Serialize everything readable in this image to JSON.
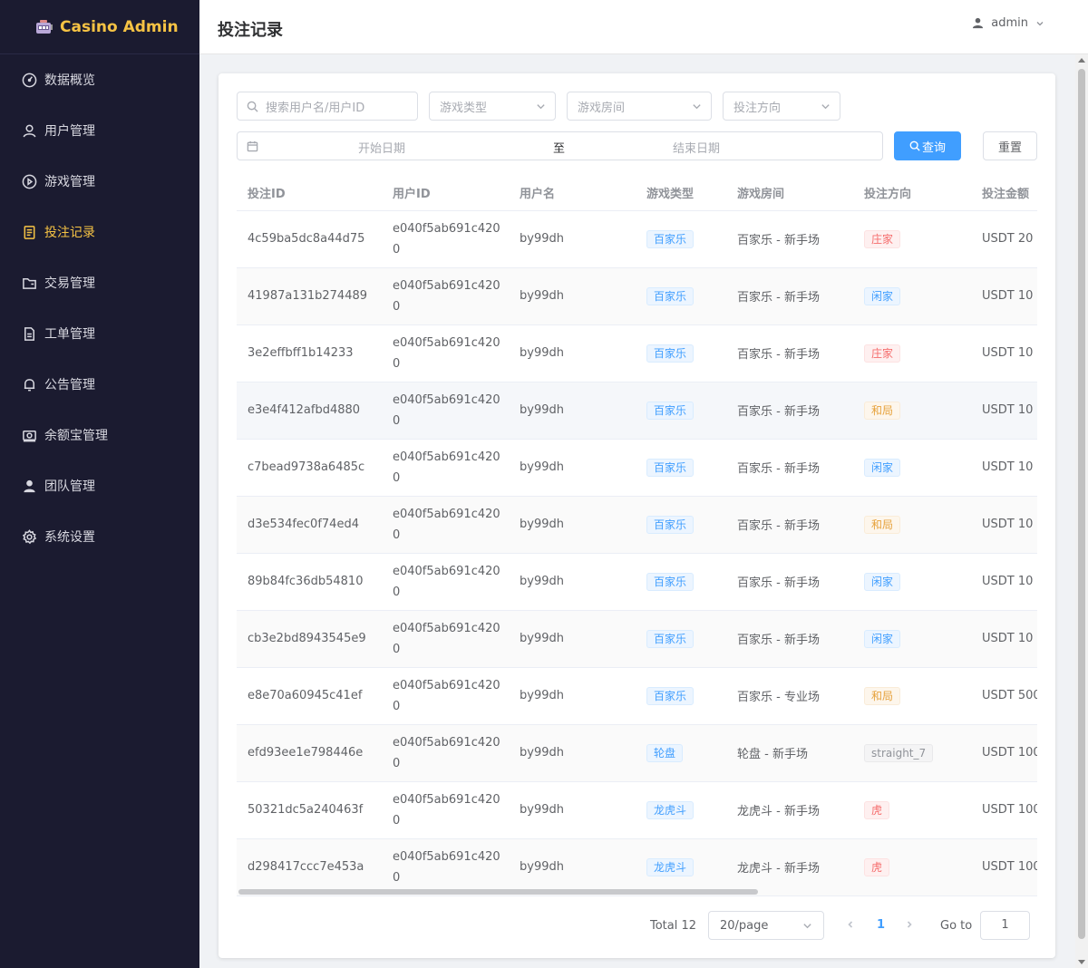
{
  "app": {
    "title": "Casino Admin"
  },
  "sidebar": {
    "items": [
      {
        "label": "数据概览",
        "icon": "dashboard-icon"
      },
      {
        "label": "用户管理",
        "icon": "user-icon"
      },
      {
        "label": "游戏管理",
        "icon": "play-circle-icon"
      },
      {
        "label": "投注记录",
        "icon": "document-icon",
        "active": true
      },
      {
        "label": "交易管理",
        "icon": "wallet-icon"
      },
      {
        "label": "工单管理",
        "icon": "ticket-icon"
      },
      {
        "label": "公告管理",
        "icon": "bell-icon"
      },
      {
        "label": "余额宝管理",
        "icon": "money-icon"
      },
      {
        "label": "团队管理",
        "icon": "team-icon"
      },
      {
        "label": "系统设置",
        "icon": "gear-icon"
      }
    ]
  },
  "header": {
    "title": "投注记录",
    "user": "admin"
  },
  "filters": {
    "search_placeholder": "搜索用户名/用户ID",
    "game_type_placeholder": "游戏类型",
    "game_room_placeholder": "游戏房间",
    "bet_direction_placeholder": "投注方向",
    "start_date_placeholder": "开始日期",
    "date_separator": "至",
    "end_date_placeholder": "结束日期",
    "query_label": "查询",
    "reset_label": "重置"
  },
  "table": {
    "columns": [
      "投注ID",
      "用户ID",
      "用户名",
      "游戏类型",
      "游戏房间",
      "投注方向",
      "投注金额"
    ],
    "rows": [
      {
        "id": "4c59ba5dc8a44d75",
        "uid": "e040f5ab691c4200",
        "name": "by99dh",
        "game": "百家乐",
        "room": "百家乐 - 新手场",
        "dir": "庄家",
        "dir_type": "banker",
        "amount": "USDT 20"
      },
      {
        "id": "41987a131b274489",
        "uid": "e040f5ab691c4200",
        "name": "by99dh",
        "game": "百家乐",
        "room": "百家乐 - 新手场",
        "dir": "闲家",
        "dir_type": "player",
        "amount": "USDT 10"
      },
      {
        "id": "3e2effbff1b14233",
        "uid": "e040f5ab691c4200",
        "name": "by99dh",
        "game": "百家乐",
        "room": "百家乐 - 新手场",
        "dir": "庄家",
        "dir_type": "banker",
        "amount": "USDT 10"
      },
      {
        "id": "e3e4f412afbd4880",
        "uid": "e040f5ab691c4200",
        "name": "by99dh",
        "game": "百家乐",
        "room": "百家乐 - 新手场",
        "dir": "和局",
        "dir_type": "tie",
        "amount": "USDT 10"
      },
      {
        "id": "c7bead9738a6485c",
        "uid": "e040f5ab691c4200",
        "name": "by99dh",
        "game": "百家乐",
        "room": "百家乐 - 新手场",
        "dir": "闲家",
        "dir_type": "player",
        "amount": "USDT 10"
      },
      {
        "id": "d3e534fec0f74ed4",
        "uid": "e040f5ab691c4200",
        "name": "by99dh",
        "game": "百家乐",
        "room": "百家乐 - 新手场",
        "dir": "和局",
        "dir_type": "tie",
        "amount": "USDT 10"
      },
      {
        "id": "89b84fc36db54810",
        "uid": "e040f5ab691c4200",
        "name": "by99dh",
        "game": "百家乐",
        "room": "百家乐 - 新手场",
        "dir": "闲家",
        "dir_type": "player",
        "amount": "USDT 10"
      },
      {
        "id": "cb3e2bd8943545e9",
        "uid": "e040f5ab691c4200",
        "name": "by99dh",
        "game": "百家乐",
        "room": "百家乐 - 新手场",
        "dir": "闲家",
        "dir_type": "player",
        "amount": "USDT 10"
      },
      {
        "id": "e8e70a60945c41ef",
        "uid": "e040f5ab691c4200",
        "name": "by99dh",
        "game": "百家乐",
        "room": "百家乐 - 专业场",
        "dir": "和局",
        "dir_type": "tie",
        "amount": "USDT 500"
      },
      {
        "id": "efd93ee1e798446e",
        "uid": "e040f5ab691c4200",
        "name": "by99dh",
        "game": "轮盘",
        "room": "轮盘 - 新手场",
        "dir": "straight_7",
        "dir_type": "other",
        "amount": "USDT 100"
      },
      {
        "id": "50321dc5a240463f",
        "uid": "e040f5ab691c4200",
        "name": "by99dh",
        "game": "龙虎斗",
        "room": "龙虎斗 - 新手场",
        "dir": "虎",
        "dir_type": "tiger",
        "amount": "USDT 100"
      },
      {
        "id": "d298417ccc7e453a",
        "uid": "e040f5ab691c4200",
        "name": "by99dh",
        "game": "龙虎斗",
        "room": "龙虎斗 - 新手场",
        "dir": "虎",
        "dir_type": "tiger",
        "amount": "USDT 100"
      }
    ]
  },
  "pagination": {
    "total": "Total 12",
    "page_size": "20/page",
    "current_page": "1",
    "goto_label": "Go to",
    "goto_value": "1"
  },
  "colors": {
    "sidebar_bg": "#1b1b30",
    "accent": "#f6c344",
    "primary": "#409eff"
  }
}
